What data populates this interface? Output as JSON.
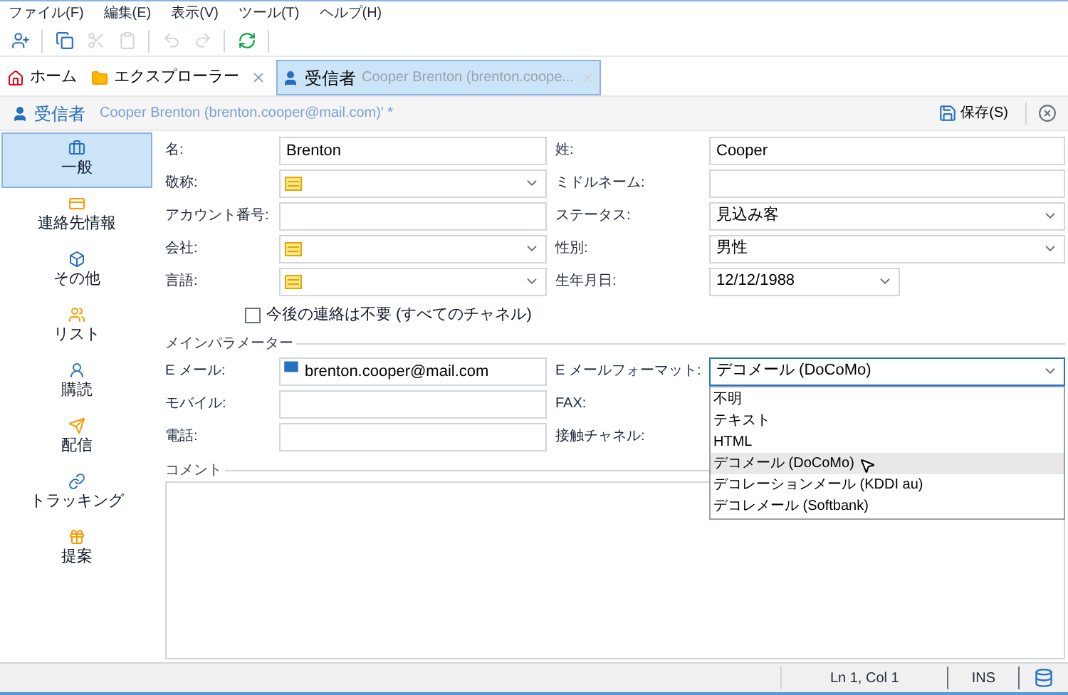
{
  "menu": [
    "ファイル(F)",
    "編集(E)",
    "表示(V)",
    "ツール(T)",
    "ヘルプ(H)"
  ],
  "toolbar": [
    {
      "disabled": false
    },
    {
      "disabled": false
    },
    {
      "disabled": true
    },
    {
      "disabled": true
    },
    {
      "disabled": true
    },
    {
      "disabled": true
    },
    {
      "disabled": false
    }
  ],
  "tabs": [
    {
      "label": "ホーム",
      "selected": false,
      "closable": false
    },
    {
      "label": "エクスプローラー",
      "selected": false,
      "closable": true
    },
    {
      "label": "受信者",
      "detail": "Cooper Brenton (brenton.coope...",
      "selected": true,
      "closable": true
    }
  ],
  "header": {
    "title": "受信者",
    "subtitle": "Cooper Brenton (brenton.cooper@mail.com)' *",
    "save": "保存(S)"
  },
  "sidebar": [
    {
      "label": "一般",
      "selected": true
    },
    {
      "label": "連絡先情報",
      "selected": false
    },
    {
      "label": "その他",
      "selected": false
    },
    {
      "label": "リスト",
      "selected": false
    },
    {
      "label": "購読",
      "selected": false
    },
    {
      "label": "配信",
      "selected": false
    },
    {
      "label": "トラッキング",
      "selected": false
    },
    {
      "label": "提案",
      "selected": false
    }
  ],
  "left_fields": [
    {
      "label": "名:",
      "kind": "text",
      "value": "Brenton"
    },
    {
      "label": "敬称:",
      "kind": "combo"
    },
    {
      "label": "アカウント番号:",
      "kind": "text"
    },
    {
      "label": "会社:",
      "kind": "combo"
    },
    {
      "label": "言語:",
      "kind": "combo"
    }
  ],
  "right_fields": [
    {
      "label": "姓:",
      "kind": "text",
      "value": "Cooper"
    },
    {
      "label": "ミドルネーム:",
      "kind": "text"
    },
    {
      "label": "ステータス:",
      "kind": "select",
      "value": "見込み客"
    },
    {
      "label": "性別:",
      "kind": "select",
      "value": "男性"
    },
    {
      "label": "生年月日:",
      "kind": "date",
      "value": "12/12/1988"
    }
  ],
  "no_contact": {
    "label": "今後の連絡は不要 (すべてのチャネル)",
    "checked": false
  },
  "main_section": {
    "title": "メインパラメーター",
    "email": {
      "label": "E メール:",
      "value": "brenton.cooper@mail.com"
    },
    "mobile": {
      "label": "モバイル:"
    },
    "phone": {
      "label": "電話:"
    },
    "email_format": {
      "label": "E メールフォーマット:",
      "value": "デコメール (DoCoMo)",
      "expanded": true,
      "options": [
        {
          "label": "不明",
          "selected": false
        },
        {
          "label": "テキスト",
          "selected": false
        },
        {
          "label": "HTML",
          "selected": false
        },
        {
          "label": "デコメール (DoCoMo)",
          "selected": true
        },
        {
          "label": "デコレーションメール (KDDI au)",
          "selected": false
        },
        {
          "label": "デコレメール (Softbank)",
          "selected": false
        }
      ]
    },
    "fax": {
      "label": "FAX:"
    },
    "channel": {
      "label": "接触チャネル:"
    }
  },
  "comment": {
    "title": "コメント"
  },
  "status_bar": {
    "position": "Ln 1, Col 1",
    "mode": "INS"
  }
}
